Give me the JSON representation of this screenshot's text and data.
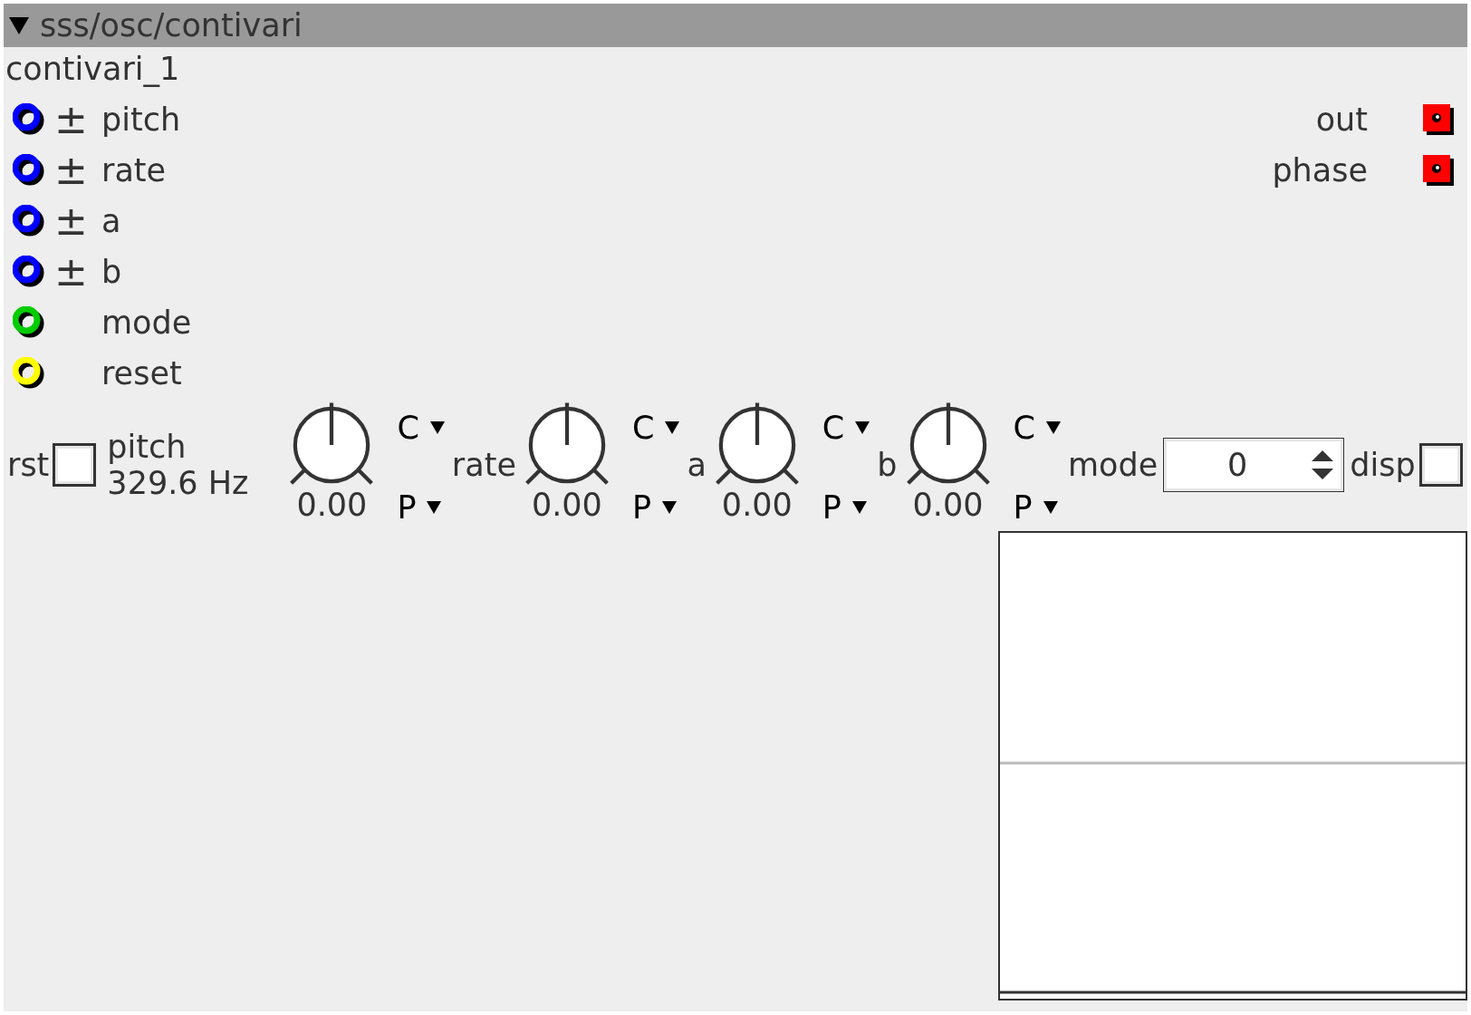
{
  "header": {
    "title": "sss/osc/contivari",
    "expanded": true
  },
  "instance_name": "contivari_1",
  "inputs": [
    {
      "name": "pitch",
      "sign": "±",
      "color": "#0000ff"
    },
    {
      "name": "rate",
      "sign": "±",
      "color": "#0000ff"
    },
    {
      "name": "a",
      "sign": "±",
      "color": "#0000ff"
    },
    {
      "name": "b",
      "sign": "±",
      "color": "#0000ff"
    },
    {
      "name": "mode",
      "color": "#00cc00"
    },
    {
      "name": "reset",
      "color": "#ffff00"
    }
  ],
  "outputs": [
    {
      "name": "out",
      "color": "#ff0000"
    },
    {
      "name": "phase",
      "color": "#ff0000"
    }
  ],
  "controls": [
    {
      "kind": "checkbox",
      "label": "rst",
      "checked": false
    },
    {
      "kind": "readout",
      "label": "pitch",
      "value": "329.6 Hz"
    },
    {
      "kind": "knob",
      "value": "0.00",
      "top_option": "C",
      "bottom_option": "P"
    },
    {
      "kind": "knob",
      "label": "rate",
      "value": "0.00",
      "top_option": "C",
      "bottom_option": "P"
    },
    {
      "kind": "knob",
      "label": "a",
      "value": "0.00",
      "top_option": "C",
      "bottom_option": "P"
    },
    {
      "kind": "knob",
      "label": "b",
      "value": "0.00",
      "top_option": "C",
      "bottom_option": "P"
    },
    {
      "kind": "spinbox",
      "label": "mode",
      "value": "0"
    },
    {
      "kind": "checkbox",
      "label": "disp",
      "checked": false
    }
  ]
}
